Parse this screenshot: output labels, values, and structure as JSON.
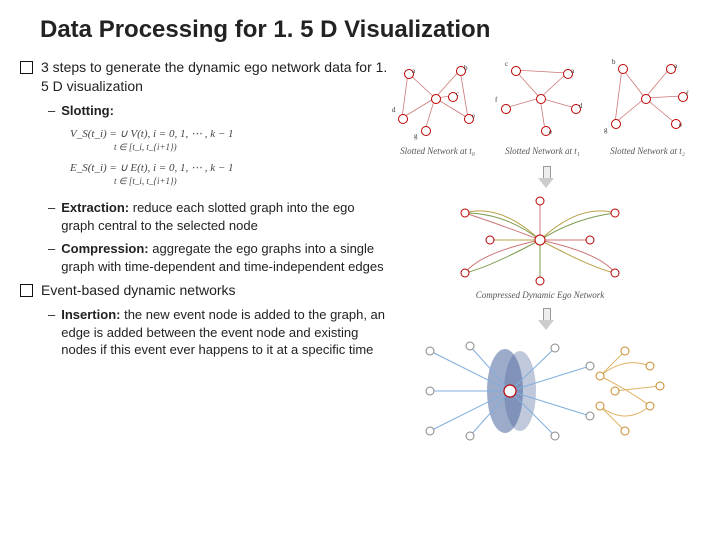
{
  "title": "Data Processing for 1. 5 D Visualization",
  "b1": "3 steps to generate the dynamic ego network data for 1. 5 D visualization",
  "s1_label": "Slotting:",
  "formula_line1": "V_S(t_i) =  ∪  V(t),   i = 0, 1, ⋯ , k − 1",
  "formula_sub1": "t ∈ [t_i, t_{i+1})",
  "formula_line2": "E_S(t_i) =  ∪  E(t),   i = 0, 1, ⋯ , k − 1",
  "formula_sub2": "t ∈ [t_i, t_{i+1})",
  "s2_label": "Extraction:",
  "s2_text": " reduce each slotted graph into the ego graph central to the selected node",
  "s3_label": "Compression:",
  "s3_text": " aggregate the ego graphs into a single graph with time-dependent and time-independent edges",
  "b2": "Event-based dynamic networks",
  "s4_label": "Insertion:",
  "s4_text": " the new event node is added to the graph, an edge is added between the event node and existing nodes if this event ever happens to it at a specific time",
  "cap1": "Slotted Network at t₀",
  "cap2": "Slotted Network at t₁",
  "cap3": "Slotted Network at t₂",
  "cap_ego": "Compressed Dynamic Ego Network"
}
